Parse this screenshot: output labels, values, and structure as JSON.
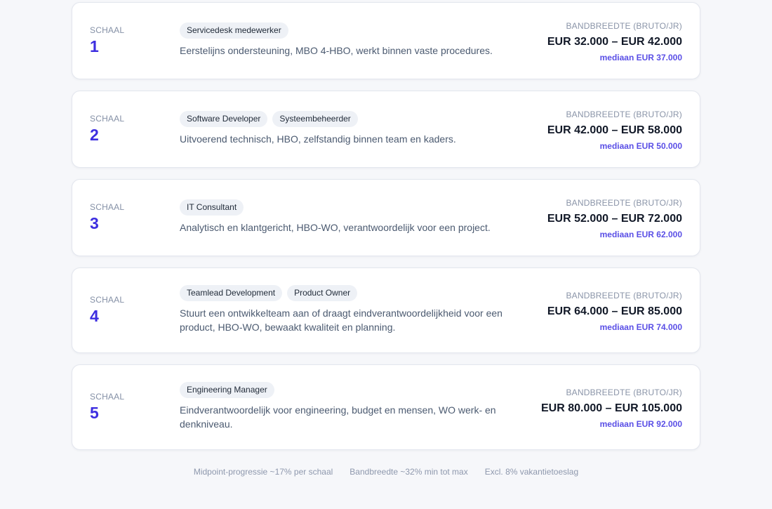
{
  "scale_label": "SCHAAL",
  "band_label": "BANDBREEDTE (BRUTO/JR)",
  "scales": [
    {
      "number": "1",
      "tags": [
        "Servicedesk medewerker"
      ],
      "description": "Eerstelijns ondersteuning, MBO 4-HBO, werkt binnen vaste procedures.",
      "range": "EUR 32.000 – EUR 42.000",
      "median": "mediaan EUR 37.000"
    },
    {
      "number": "2",
      "tags": [
        "Software Developer",
        "Systeembeheerder"
      ],
      "description": "Uitvoerend technisch, HBO, zelfstandig binnen team en kaders.",
      "range": "EUR 42.000 – EUR 58.000",
      "median": "mediaan EUR 50.000"
    },
    {
      "number": "3",
      "tags": [
        "IT Consultant"
      ],
      "description": "Analytisch en klantgericht, HBO-WO, verantwoordelijk voor een project.",
      "range": "EUR 52.000 – EUR 72.000",
      "median": "mediaan EUR 62.000"
    },
    {
      "number": "4",
      "tags": [
        "Teamlead Development",
        "Product Owner"
      ],
      "description": "Stuurt een ontwikkelteam aan of draagt eindverantwoordelijkheid voor een product, HBO-WO, bewaakt kwaliteit en planning.",
      "range": "EUR 64.000 – EUR 85.000",
      "median": "mediaan EUR 74.000"
    },
    {
      "number": "5",
      "tags": [
        "Engineering Manager"
      ],
      "description": "Eindverantwoordelijk voor engineering, budget en mensen, WO werk- en denkniveau.",
      "range": "EUR 80.000 – EUR 105.000",
      "median": "mediaan EUR 92.000"
    }
  ],
  "footer": [
    "Midpoint-progressie ~17% per schaal",
    "Bandbreedte ~32% min tot max",
    "Excl. 8% vakantietoeslag"
  ]
}
